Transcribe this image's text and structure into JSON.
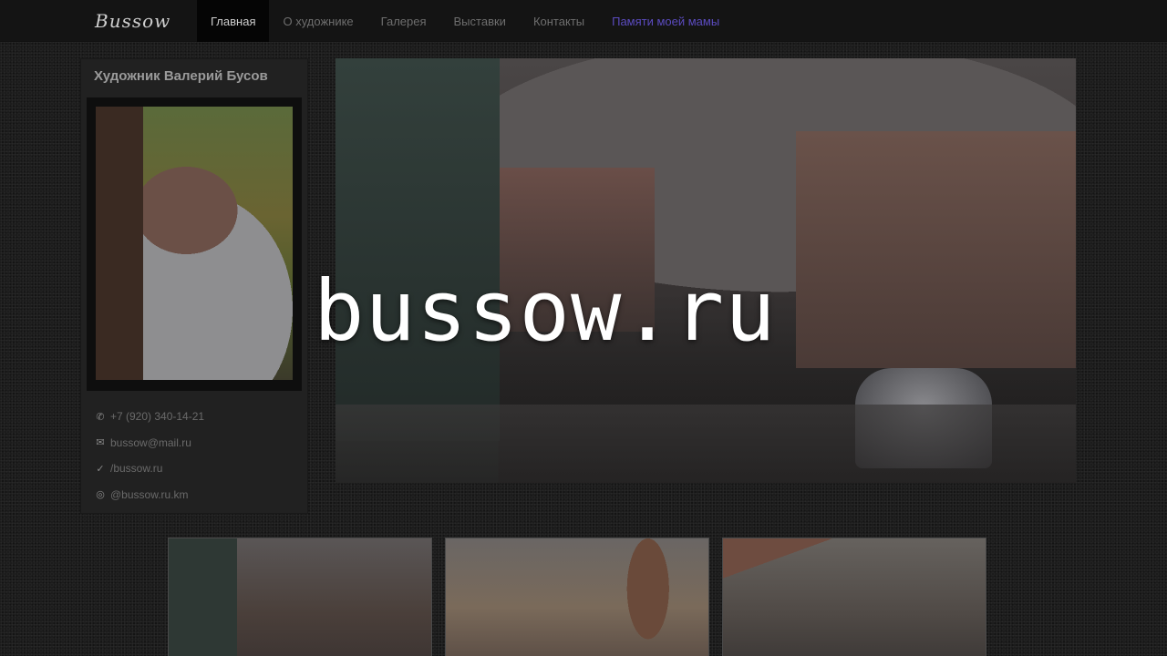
{
  "brand": {
    "logo_text": "Bussow"
  },
  "nav": {
    "items": [
      {
        "label": "Главная",
        "active": true
      },
      {
        "label": "О художнике",
        "active": false
      },
      {
        "label": "Галерея",
        "active": false
      },
      {
        "label": "Выставки",
        "active": false
      },
      {
        "label": "Контакты",
        "active": false
      },
      {
        "label": "Памяти моей мамы",
        "active": false,
        "accent": "#5b4bbf"
      }
    ]
  },
  "sidebar": {
    "title": "Художник Валерий Бусов",
    "contacts": [
      {
        "icon": "phone-icon",
        "text": "+7 (920) 340-14-21"
      },
      {
        "icon": "mail-icon",
        "text": "bussow@mail.ru"
      },
      {
        "icon": "vk-icon",
        "text": "/bussow.ru"
      },
      {
        "icon": "instagram-icon",
        "text": "@bussow.ru.km"
      }
    ]
  },
  "hero": {
    "title": "bussow.ru"
  },
  "thumbnails": [
    {
      "alt": "painting-1"
    },
    {
      "alt": "painting-2"
    },
    {
      "alt": "painting-3"
    }
  ]
}
